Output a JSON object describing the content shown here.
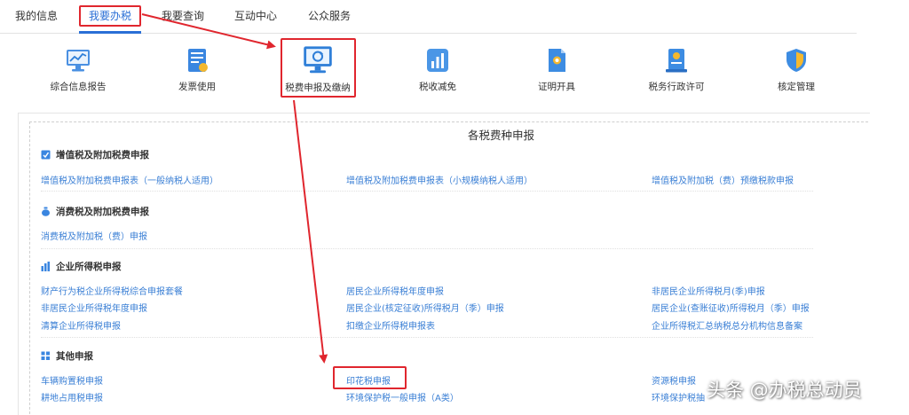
{
  "tabs": [
    {
      "label": "我的信息"
    },
    {
      "label": "我要办税",
      "active": true
    },
    {
      "label": "我要查询"
    },
    {
      "label": "互动中心"
    },
    {
      "label": "公众服务"
    }
  ],
  "services": [
    {
      "label": "综合信息报告",
      "icon": "monitor-chart-icon"
    },
    {
      "label": "发票使用",
      "icon": "invoice-document-icon"
    },
    {
      "label": "税费申报及缴纳",
      "icon": "computer-refresh-icon"
    },
    {
      "label": "税收减免",
      "icon": "bar-chart-icon"
    },
    {
      "label": "证明开具",
      "icon": "certificate-document-icon"
    },
    {
      "label": "税务行政许可",
      "icon": "license-document-icon"
    },
    {
      "label": "核定管理",
      "icon": "shield-icon"
    }
  ],
  "panel": {
    "title": "各税费种申报",
    "sections": [
      {
        "title": "增值税及附加税费申报",
        "icon": "edit-checkbox-icon",
        "links": [
          "增值税及附加税费申报表（一般纳税人适用）",
          "增值税及附加税费申报表（小规模纳税人适用）",
          "增值税及附加税（费）预缴税款申报"
        ]
      },
      {
        "title": "消费税及附加税费申报",
        "icon": "money-bag-icon",
        "links": [
          "消费税及附加税（费）申报"
        ]
      },
      {
        "title": "企业所得税申报",
        "icon": "building-chart-icon",
        "links": [
          "财产行为税企业所得税综合申报套餐",
          "居民企业所得税年度申报",
          "非居民企业所得税月(季)申报",
          "非居民企业所得税年度申报",
          "居民企业(核定征收)所得税月（季）申报",
          "居民企业(查账征收)所得税月（季）申报",
          "清算企业所得税申报",
          "扣缴企业所得税申报表",
          "企业所得税汇总纳税总分机构信息备案"
        ]
      },
      {
        "title": "其他申报",
        "icon": "grid-icon",
        "links": [
          "车辆购置税申报",
          "印花税申报",
          "资源税申报",
          "耕地占用税申报",
          "环境保护税一般申报（A类）",
          "环境保护税抽"
        ]
      }
    ]
  },
  "watermark": "头条 @办税总动员",
  "colors": {
    "accent": "#2a6fd6",
    "link": "#3a7fd5",
    "annotation": "#e0262e"
  }
}
